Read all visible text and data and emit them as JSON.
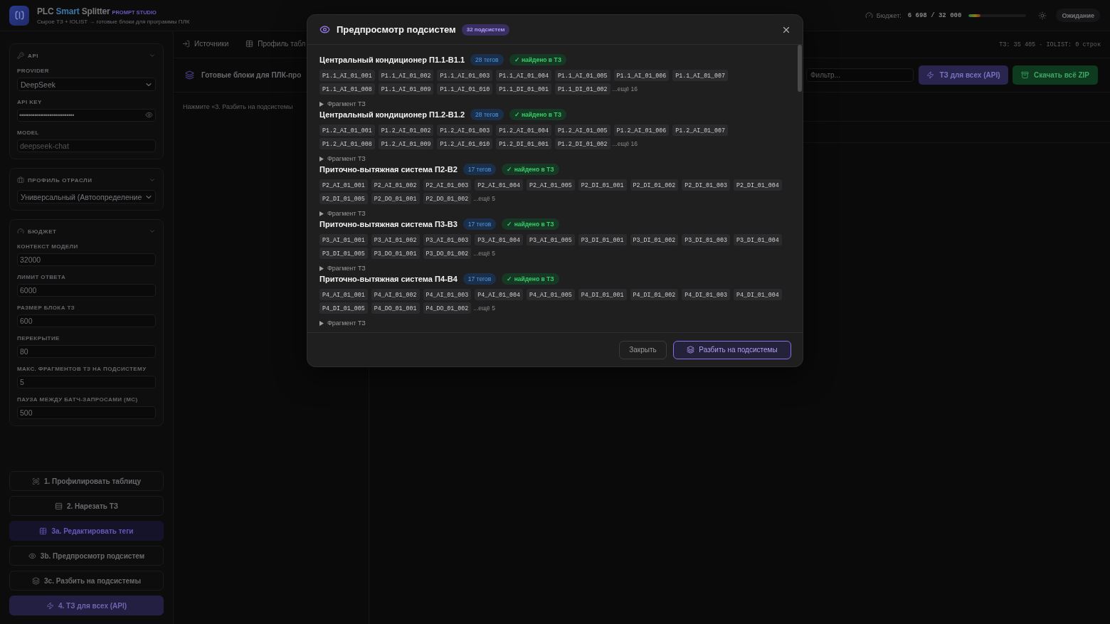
{
  "header": {
    "title": [
      {
        "text": "PLC",
        "accent": false
      },
      {
        "text": "Smart",
        "accent": true
      },
      {
        "text": "Splitter",
        "accent": false
      }
    ],
    "tag": "PROMPT STUDIO",
    "subtitle": "Сырое ТЗ + IOLIST → готовые блоки для программы ПЛК",
    "budget": {
      "label": "Бюджет:",
      "value": "6 698 / 32 000",
      "level": 0.21
    },
    "status": "Ожидание"
  },
  "sidebar": {
    "sections": [
      {
        "kind": "api",
        "title": "API",
        "expanded": true,
        "fields": [
          {
            "kind": "select",
            "label": "PROVIDER",
            "value": "DeepSeek"
          },
          {
            "kind": "secret",
            "label": "API KEY",
            "value": "•••••••••••••••••••••••••••••"
          },
          {
            "kind": "text",
            "label": "MODEL",
            "placeholder": "deepseek-chat"
          }
        ]
      },
      {
        "kind": "profile",
        "title": "ПРОФИЛЬ ОТРАСЛИ",
        "expanded": true,
        "fields": [
          {
            "kind": "select",
            "value": "Универсальный (Автоопределение"
          }
        ]
      },
      {
        "kind": "budget",
        "title": "БЮДЖЕТ",
        "expanded": true,
        "fields": [
          {
            "kind": "number",
            "label": "КОНТЕКСТ МОДЕЛИ",
            "value": "32000"
          },
          {
            "kind": "number",
            "label": "ЛИМИТ ОТВЕТА",
            "value": "6000"
          },
          {
            "kind": "number",
            "label": "РАЗМЕР БЛОКА ТЗ",
            "value": "600"
          },
          {
            "kind": "number",
            "label": "ПЕРЕКРЫТИЕ",
            "value": "80"
          },
          {
            "kind": "number",
            "label": "МАКС. ФРАГМЕНТОВ ТЗ НА ПОДСИСТЕМУ",
            "value": "5"
          },
          {
            "kind": "number",
            "label": "ПАУЗА МЕЖДУ БАТЧ-ЗАПРОСАМИ (МС)",
            "value": "500"
          }
        ]
      }
    ],
    "actions": [
      {
        "label": "1. Профилировать таблицу",
        "kind": "outline"
      },
      {
        "label": "2. Нарезать ТЗ",
        "kind": "outline"
      },
      {
        "label": "3a. Редактировать теги",
        "kind": "accent"
      },
      {
        "label": "3b. Предпросмотр подсистем",
        "kind": "outline"
      },
      {
        "label": "3c. Разбить на подсистемы",
        "kind": "outline"
      },
      {
        "label": "4. ТЗ для всех (API)",
        "kind": "primary"
      }
    ]
  },
  "main": {
    "tabs": [
      {
        "label": "Источники",
        "selected": false
      },
      {
        "label": "Профиль табл",
        "selected": false
      }
    ],
    "stats": "ТЗ: 35 405 · IOLIST: 0 строк",
    "panel": {
      "title": "Готовые блоки для ПЛК-про",
      "filter": {
        "placeholder": "Фильтр..."
      },
      "buttons": [
        {
          "label": "ТЗ для всех (API)",
          "kind": "primary"
        },
        {
          "label": "Скачать всё ZIP",
          "kind": "success"
        }
      ],
      "hint": "Нажмите «3. Разбить на подсистемы"
    }
  },
  "modal": {
    "title": "Предпросмотр подсистем",
    "count": "32 подсистем",
    "subsystems": [
      {
        "name": "Центральный кондиционер П1.1-В1.1",
        "tag_count": "28 тегов",
        "found": true,
        "status": "✓ найдено в ТЗ",
        "tags": [
          "P1.1_AI_01_001",
          "P1.1_AI_01_002",
          "P1.1_AI_01_003",
          "P1.1_AI_01_004",
          "P1.1_AI_01_005",
          "P1.1_AI_01_006",
          "P1.1_AI_01_007",
          "P1.1_AI_01_008",
          "P1.1_AI_01_009",
          "P1.1_AI_01_010",
          "P1.1_DI_01_001",
          "P1.1_DI_01_002"
        ],
        "more": "...ещё 16",
        "fragment": {
          "label": "Фрагмент ТЗ",
          "expanded": false
        }
      },
      {
        "name": "Центральный кондиционер П1.2-В1.2",
        "tag_count": "28 тегов",
        "found": true,
        "status": "✓ найдено в ТЗ",
        "tags": [
          "P1.2_AI_01_001",
          "P1.2_AI_01_002",
          "P1.2_AI_01_003",
          "P1.2_AI_01_004",
          "P1.2_AI_01_005",
          "P1.2_AI_01_006",
          "P1.2_AI_01_007",
          "P1.2_AI_01_008",
          "P1.2_AI_01_009",
          "P1.2_AI_01_010",
          "P1.2_DI_01_001",
          "P1.2_DI_01_002"
        ],
        "more": "...ещё 16",
        "fragment": {
          "label": "Фрагмент ТЗ",
          "expanded": false
        }
      },
      {
        "name": "Приточно-вытяжная система П2-В2",
        "tag_count": "17 тегов",
        "found": true,
        "status": "✓ найдено в ТЗ",
        "tags": [
          "P2_AI_01_001",
          "P2_AI_01_002",
          "P2_AI_01_003",
          "P2_AI_01_004",
          "P2_AI_01_005",
          "P2_DI_01_001",
          "P2_DI_01_002",
          "P2_DI_01_003",
          "P2_DI_01_004",
          "P2_DI_01_005",
          "P2_DO_01_001",
          "P2_DO_01_002"
        ],
        "more": "...ещё 5",
        "fragment": {
          "label": "Фрагмент ТЗ",
          "expanded": false
        }
      },
      {
        "name": "Приточно-вытяжная система П3-В3",
        "tag_count": "17 тегов",
        "found": true,
        "status": "✓ найдено в ТЗ",
        "tags": [
          "P3_AI_01_001",
          "P3_AI_01_002",
          "P3_AI_01_003",
          "P3_AI_01_004",
          "P3_AI_01_005",
          "P3_DI_01_001",
          "P3_DI_01_002",
          "P3_DI_01_003",
          "P3_DI_01_004",
          "P3_DI_01_005",
          "P3_DO_01_001",
          "P3_DO_01_002"
        ],
        "more": "...ещё 5",
        "fragment": {
          "label": "Фрагмент ТЗ",
          "expanded": false
        }
      },
      {
        "name": "Приточно-вытяжная система П4-В4",
        "tag_count": "17 тегов",
        "found": true,
        "status": "✓ найдено в ТЗ",
        "tags": [
          "P4_AI_01_001",
          "P4_AI_01_002",
          "P4_AI_01_003",
          "P4_AI_01_004",
          "P4_AI_01_005",
          "P4_DI_01_001",
          "P4_DI_01_002",
          "P4_DI_01_003",
          "P4_DI_01_004",
          "P4_DI_01_005",
          "P4_DO_01_001",
          "P4_DO_01_002"
        ],
        "more": "...ещё 5",
        "fragment": {
          "label": "Фрагмент ТЗ",
          "expanded": false
        }
      }
    ],
    "buttons": [
      {
        "label": "Закрыть",
        "kind": "secondary"
      },
      {
        "label": "Разбить на подсистемы",
        "kind": "primary"
      }
    ]
  }
}
